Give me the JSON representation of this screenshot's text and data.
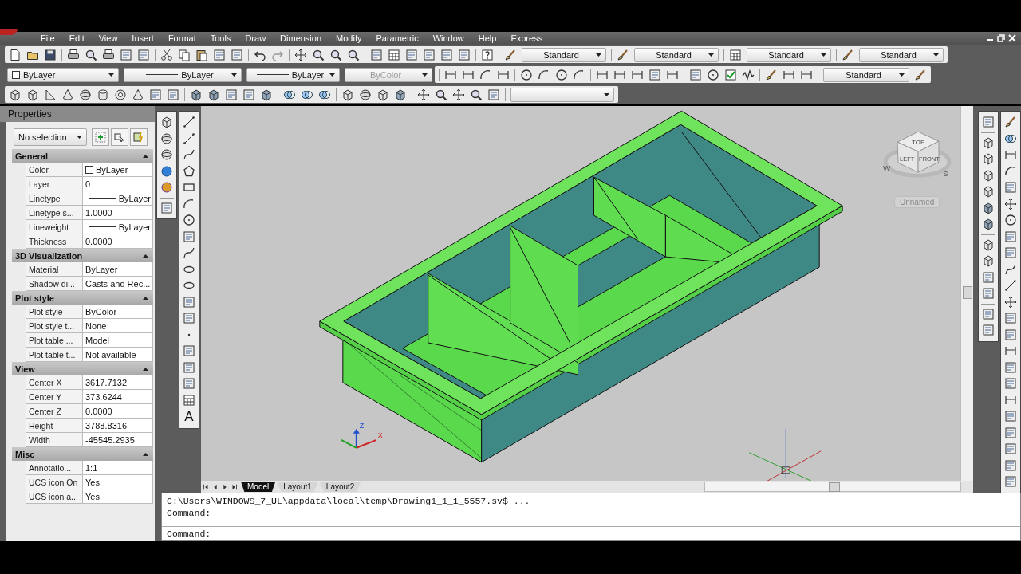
{
  "menu": [
    {
      "label": "File"
    },
    {
      "label": "Edit"
    },
    {
      "label": "View"
    },
    {
      "label": "Insert"
    },
    {
      "label": "Format"
    },
    {
      "label": "Tools"
    },
    {
      "label": "Draw"
    },
    {
      "label": "Dimension"
    },
    {
      "label": "Modify"
    },
    {
      "label": "Parametric"
    },
    {
      "label": "Window"
    },
    {
      "label": "Help"
    },
    {
      "label": "Express"
    }
  ],
  "toolbars": [
    {
      "dropdowns": [
        {
          "value": "Standard",
          "kind": "plain",
          "disabled": false
        },
        {
          "value": "Standard",
          "kind": "plain",
          "disabled": false
        },
        {
          "value": "Standard",
          "kind": "plain",
          "disabled": false
        },
        {
          "value": "Standard",
          "kind": "plain",
          "disabled": false
        }
      ]
    },
    {
      "dropdowns": [
        {
          "value": "ByLayer",
          "kind": "color",
          "disabled": false
        },
        {
          "value": "ByLayer",
          "kind": "line",
          "disabled": false
        },
        {
          "value": "ByLayer",
          "kind": "line",
          "disabled": false
        },
        {
          "value": "ByColor",
          "kind": "plain",
          "disabled": true
        },
        {
          "value": "Standard",
          "kind": "plain",
          "disabled": false
        }
      ]
    },
    {
      "dropdowns": [
        {
          "kind": "plain"
        }
      ]
    }
  ],
  "properties": {
    "title": "Properties",
    "selection": "No selection",
    "sections": [
      {
        "title": "General",
        "expanded": true,
        "rows": [
          {
            "label": "Color",
            "value": "ByLayer",
            "kind": "color"
          },
          {
            "label": "Layer",
            "value": "0",
            "kind": "plain"
          },
          {
            "label": "Linetype",
            "value": "ByLayer",
            "kind": "line"
          },
          {
            "label": "Linetype s...",
            "value": "1.0000",
            "kind": "plain"
          },
          {
            "label": "Lineweight",
            "value": "ByLayer",
            "kind": "line"
          },
          {
            "label": "Thickness",
            "value": "0.0000",
            "kind": "plain"
          }
        ]
      },
      {
        "title": "3D Visualization",
        "expanded": true,
        "rows": [
          {
            "label": "Material",
            "value": "ByLayer",
            "kind": "plain"
          },
          {
            "label": "Shadow di...",
            "value": "Casts and Rec...",
            "kind": "plain"
          }
        ]
      },
      {
        "title": "Plot style",
        "expanded": true,
        "rows": [
          {
            "label": "Plot style",
            "value": "ByColor",
            "kind": "plain"
          },
          {
            "label": "Plot style t...",
            "value": "None",
            "kind": "plain"
          },
          {
            "label": "Plot table ...",
            "value": "Model",
            "kind": "plain"
          },
          {
            "label": "Plot table t...",
            "value": "Not available",
            "kind": "plain"
          }
        ]
      },
      {
        "title": "View",
        "expanded": true,
        "rows": [
          {
            "label": "Center X",
            "value": "3617.7132",
            "kind": "plain"
          },
          {
            "label": "Center Y",
            "value": "373.6244",
            "kind": "plain"
          },
          {
            "label": "Center Z",
            "value": "0.0000",
            "kind": "plain"
          },
          {
            "label": "Height",
            "value": "3788.8316",
            "kind": "plain"
          },
          {
            "label": "Width",
            "value": "-45545.2935",
            "kind": "plain"
          }
        ]
      },
      {
        "title": "Misc",
        "expanded": true,
        "rows": [
          {
            "label": "Annotatio...",
            "value": "1:1",
            "kind": "plain"
          },
          {
            "label": "UCS icon On",
            "value": "Yes",
            "kind": "plain"
          },
          {
            "label": "UCS icon a...",
            "value": "Yes",
            "kind": "plain"
          }
        ]
      }
    ]
  },
  "draw_toolbar": {
    "text_button": "A"
  },
  "viewport": {
    "viewcube": {
      "faces": [
        "TOP",
        "LEFT",
        "FRONT"
      ],
      "compass": [
        "W",
        "S"
      ],
      "view": "Unnamed"
    },
    "ucs_labels": [
      "Z",
      "X"
    ]
  },
  "layout_tabs": [
    {
      "label": "Model",
      "selected": true
    },
    {
      "label": "Layout1",
      "selected": false
    },
    {
      "label": "Layout2",
      "selected": false
    }
  ],
  "command": {
    "history": [
      "C:\\Users\\WINDOWS_7_UL\\appdata\\local\\temp\\Drawing1_1_1_5557.sv$ ...",
      "Command:"
    ],
    "prompt": "Command:"
  }
}
